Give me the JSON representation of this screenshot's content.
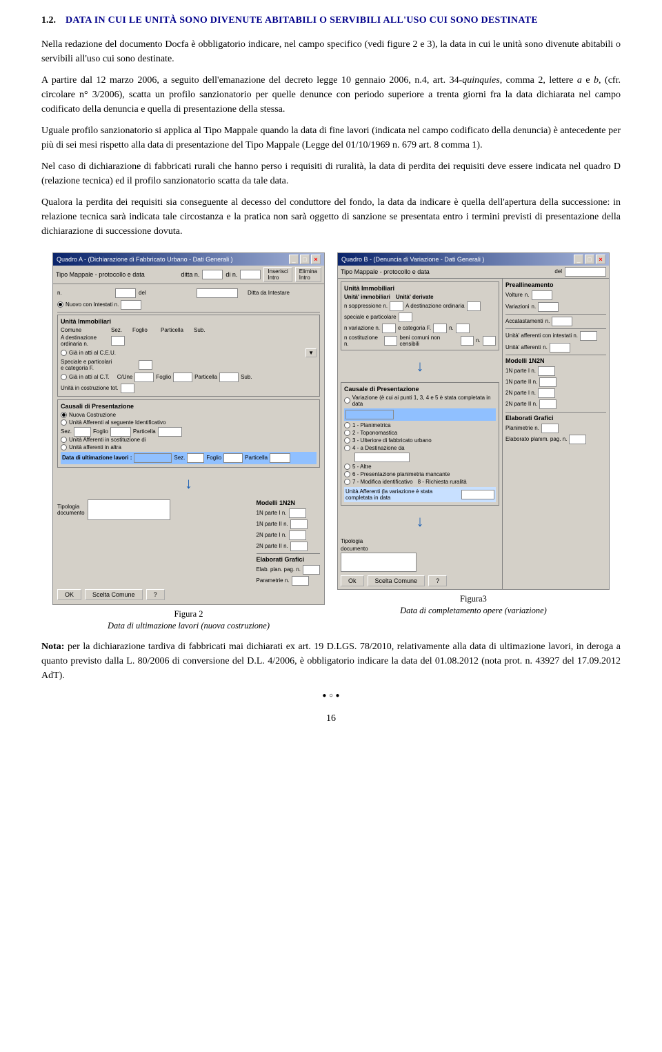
{
  "section": {
    "number": "1.2.",
    "title": "Data in cui le unità sono divenute abitabili o servibili all'uso cui sono destinate"
  },
  "paragraphs": {
    "p1": "Nella redazione del documento Docfa è obbligatorio indicare, nel campo specifico (vedi figure 2 e 3), la data in cui le unità sono divenute abitabili o servibili all'uso cui sono destinate.",
    "p2": "A partire dal 12 marzo 2006, a seguito dell'emanazione del decreto legge 10 gennaio 2006, n.4, art. 34-quinquies, comma 2, lettere a e b, (cfr. circolare n° 3/2006), scatta un profilo sanzionatorio per quelle denunce con periodo superiore a trenta giorni fra la data dichiarata nel campo codificato della denuncia e quella di presentazione della stessa.",
    "p3": "Uguale profilo sanzionatorio si applica al Tipo Mappale quando la data di fine lavori (indicata nel campo codificato della denuncia) è antecedente per più di sei mesi rispetto alla data di presentazione del Tipo Mappale (Legge del 01/10/1969 n. 679 art. 8 comma 1).",
    "p4": "Nel caso di dichiarazione di fabbricati rurali che hanno perso i requisiti di ruralità, la data di perdita dei requisiti deve essere indicata nel quadro D (relazione tecnica) ed il profilo sanzionatorio scatta da tale data.",
    "p5": "Qualora la perdita dei requisiti sia conseguente al decesso del conduttore del fondo, la data da indicare è quella dell'apertura della successione: in relazione tecnica sarà indicata tale circostanza e la pratica non sarà oggetto di sanzione se presentata entro i termini previsti di presentazione della dichiarazione di successione dovuta."
  },
  "figure2": {
    "title": "Quadro A - (Dichiarazione di Fabbricato Urbano - Dati Generali)",
    "caption_bold": "Figura 2",
    "caption_text": "Data di ultimazione lavori (nuova costruzione)"
  },
  "figure3": {
    "title": "Quadro B - (Denuncia di Variazione - Dati Generali)",
    "caption_bold": "Figura3",
    "caption_text": "Data di completamento opere (variazione)"
  },
  "nota": {
    "text": "Nota: per la dichiarazione tardiva di fabbricati mai dichiarati ex art. 19 D.LGS. 78/2010, relativamente alla data di ultimazione lavori, in deroga a quanto previsto dalla L. 80/2006 di conversione del D.L. 4/2006, è obbligatorio indicare la data del 01.08.2012 (nota prot. n. 43927 del 17.09.2012 AdT)."
  },
  "page_number": "16"
}
